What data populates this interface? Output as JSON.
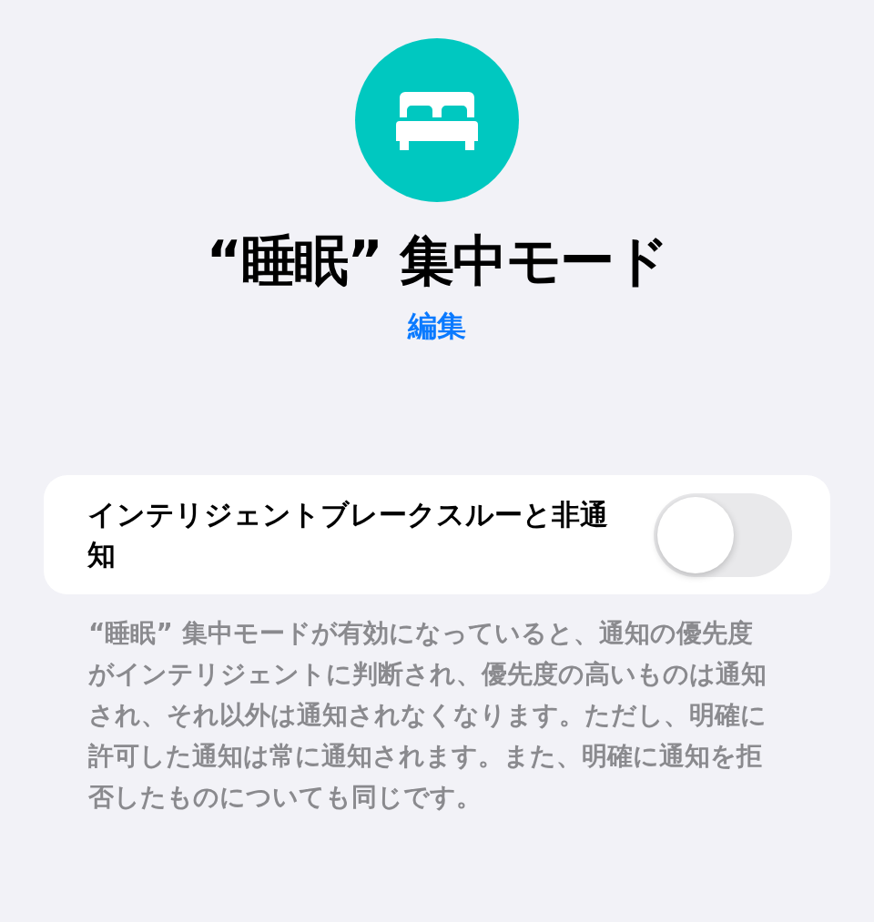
{
  "header": {
    "title": "“睡眠” 集中モード",
    "edit_link": "編集"
  },
  "setting": {
    "label": "インテリジェントブレークスルーと非通知",
    "on": false
  },
  "footer": "“睡眠” 集中モードが有効になっていると、通知の優先度がインテリジェントに判断され、優先度の高いものは通知され、それ以外は通知されなくなります。ただし、明確に許可した通知は常に通知されます。また、明確に通知を拒否したものについても同じです。"
}
